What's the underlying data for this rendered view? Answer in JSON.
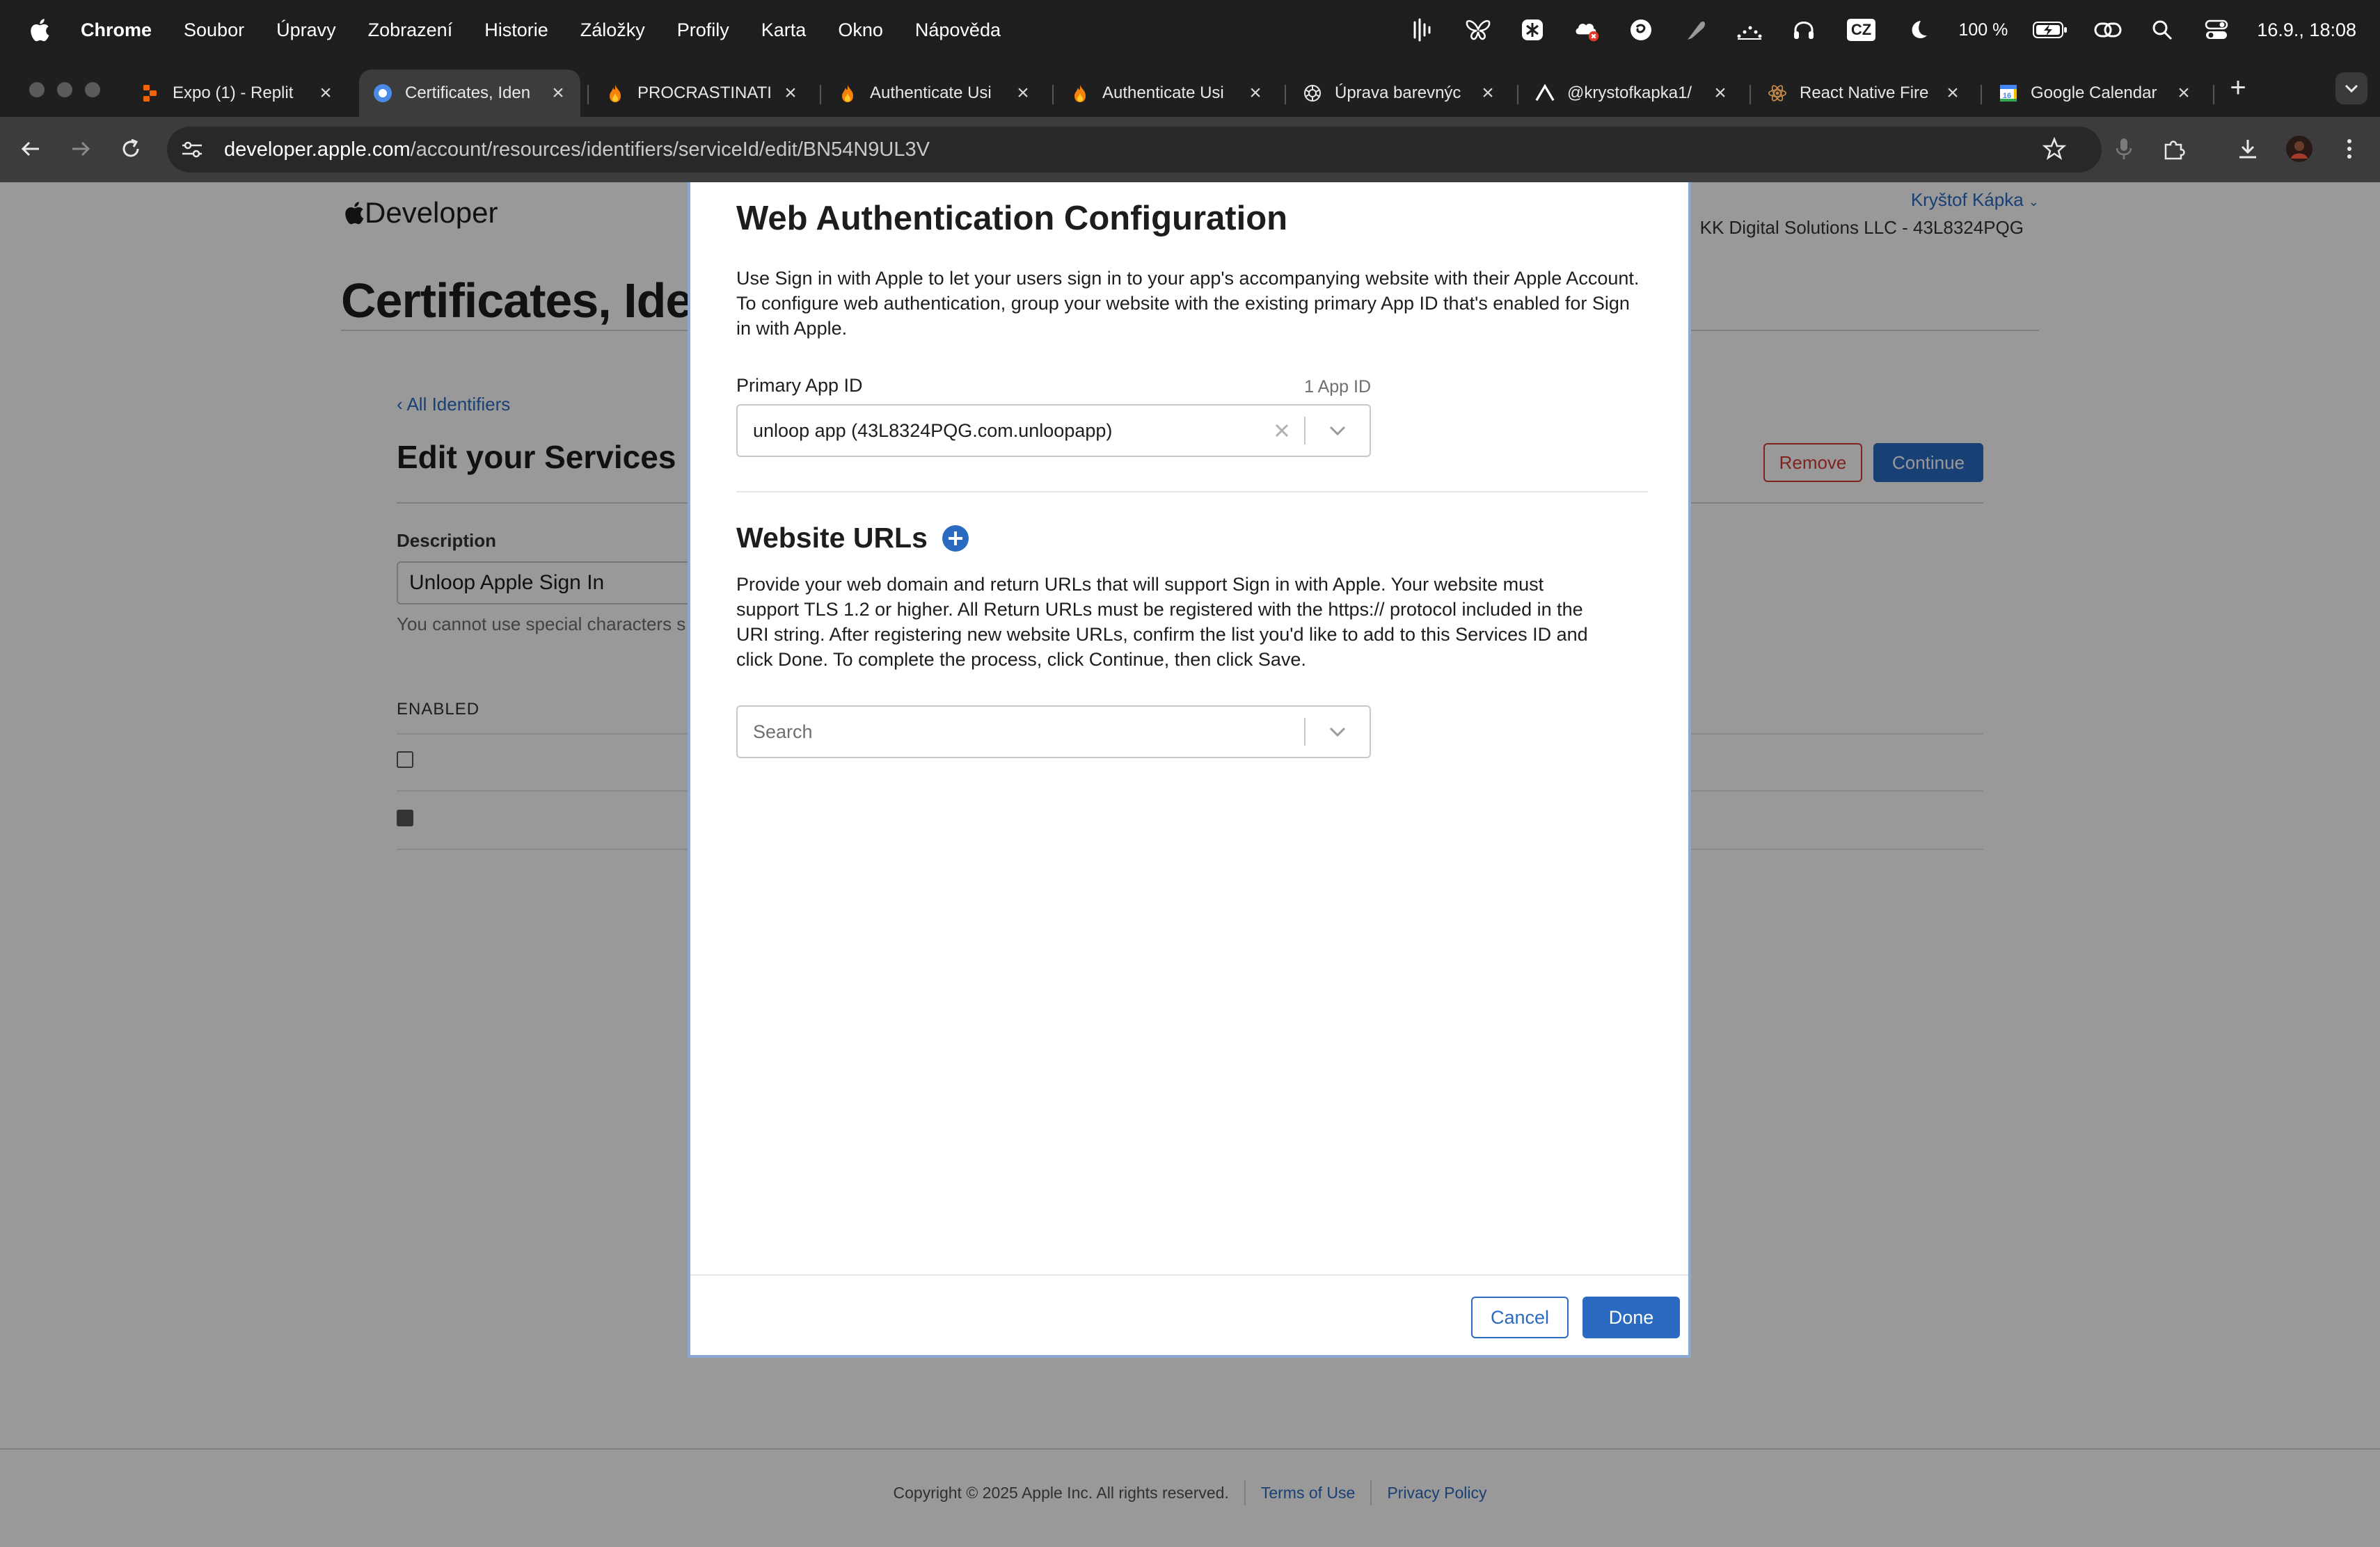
{
  "menubar": {
    "app": "Chrome",
    "items": [
      "Soubor",
      "Úpravy",
      "Zobrazení",
      "Historie",
      "Záložky",
      "Profily",
      "Karta",
      "Okno",
      "Nápověda"
    ],
    "keyboard": "CZ",
    "battery": "100 %",
    "clock": "16.9., 18:08"
  },
  "tabs": [
    {
      "title": "Expo (1) - Replit",
      "icon": "replit-icon"
    },
    {
      "title": "Certificates, Iden",
      "icon": "apple-dev-icon",
      "active": true
    },
    {
      "title": "PROCRASTINATI",
      "icon": "fire-icon"
    },
    {
      "title": "Authenticate Usi",
      "icon": "fire-icon"
    },
    {
      "title": "Authenticate Usi",
      "icon": "fire-icon"
    },
    {
      "title": "Úprava barevnýc",
      "icon": "openai-icon"
    },
    {
      "title": "@krystofkapka1/",
      "icon": "mountain-icon"
    },
    {
      "title": "React Native Fire",
      "icon": "react-icon"
    },
    {
      "title": "Google Calendar",
      "icon": "calendar-icon"
    }
  ],
  "toolbar": {
    "url_host": "developer.apple.com",
    "url_path": "/account/resources/identifiers/serviceId/edit/BN54N9UL3V"
  },
  "page": {
    "logo": "Developer",
    "user": "Kryštof Kápka",
    "team": "KK Digital Solutions LLC - 43L8324PQG",
    "title": "Certificates, Ide",
    "back_link": "‹ All Identifiers",
    "edit_title": "Edit your Services",
    "remove": "Remove",
    "continue": "Continue",
    "description_label": "Description",
    "description_value": "Unloop Apple Sign In",
    "description_note": "You cannot use special characters s",
    "enabled_label": "ENABLED",
    "footer": {
      "copyright": "Copyright © 2025 Apple Inc. All rights reserved.",
      "terms": "Terms of Use",
      "privacy": "Privacy Policy"
    }
  },
  "modal": {
    "title": "Web Authentication Configuration",
    "intro": "Use Sign in with Apple to let your users sign in to your app's accompanying website with their Apple Account. To configure web authentication, group your website with the existing primary App ID that's enabled for Sign in with Apple.",
    "primary_label": "Primary App ID",
    "primary_count": "1 App ID",
    "primary_value": "unloop app (43L8324PQG.com.unloopapp)",
    "urls_heading": "Website URLs",
    "urls_body": "Provide your web domain and return URLs that will support Sign in with Apple. Your website must support TLS 1.2 or higher. All Return URLs must be registered with the https:// protocol included in the URI string. After registering new website URLs, confirm the list you'd like to add to this Services ID and click Done. To complete the process, click Continue, then click Save.",
    "search_placeholder": "Search",
    "cancel": "Cancel",
    "done": "Done"
  },
  "colors": {
    "accent": "#2a6bc1",
    "danger": "#d83a3a"
  }
}
